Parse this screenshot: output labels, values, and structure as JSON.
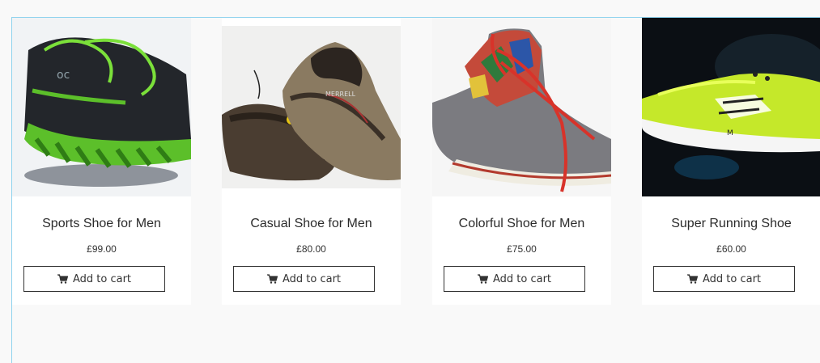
{
  "products": [
    {
      "title": "Sports Shoe for Men",
      "price": "£99.00",
      "button_label": "Add to cart",
      "image": "sports-shoe-image"
    },
    {
      "title": "Casual Shoe for Men",
      "price": "£80.00",
      "button_label": "Add to cart",
      "image": "casual-shoe-image"
    },
    {
      "title": "Colorful Shoe for Men",
      "price": "£75.00",
      "button_label": "Add to cart",
      "image": "colorful-shoe-image"
    },
    {
      "title": "Super Running Shoe",
      "price": "£60.00",
      "button_label": "Add to cart",
      "image": "running-shoe-image"
    }
  ],
  "icons": {
    "cart": "cart-icon"
  },
  "colors": {
    "frame_border": "#8fd3ee",
    "button_border": "#333333",
    "card_bg": "#ffffff",
    "page_bg": "#f9f9f9"
  }
}
